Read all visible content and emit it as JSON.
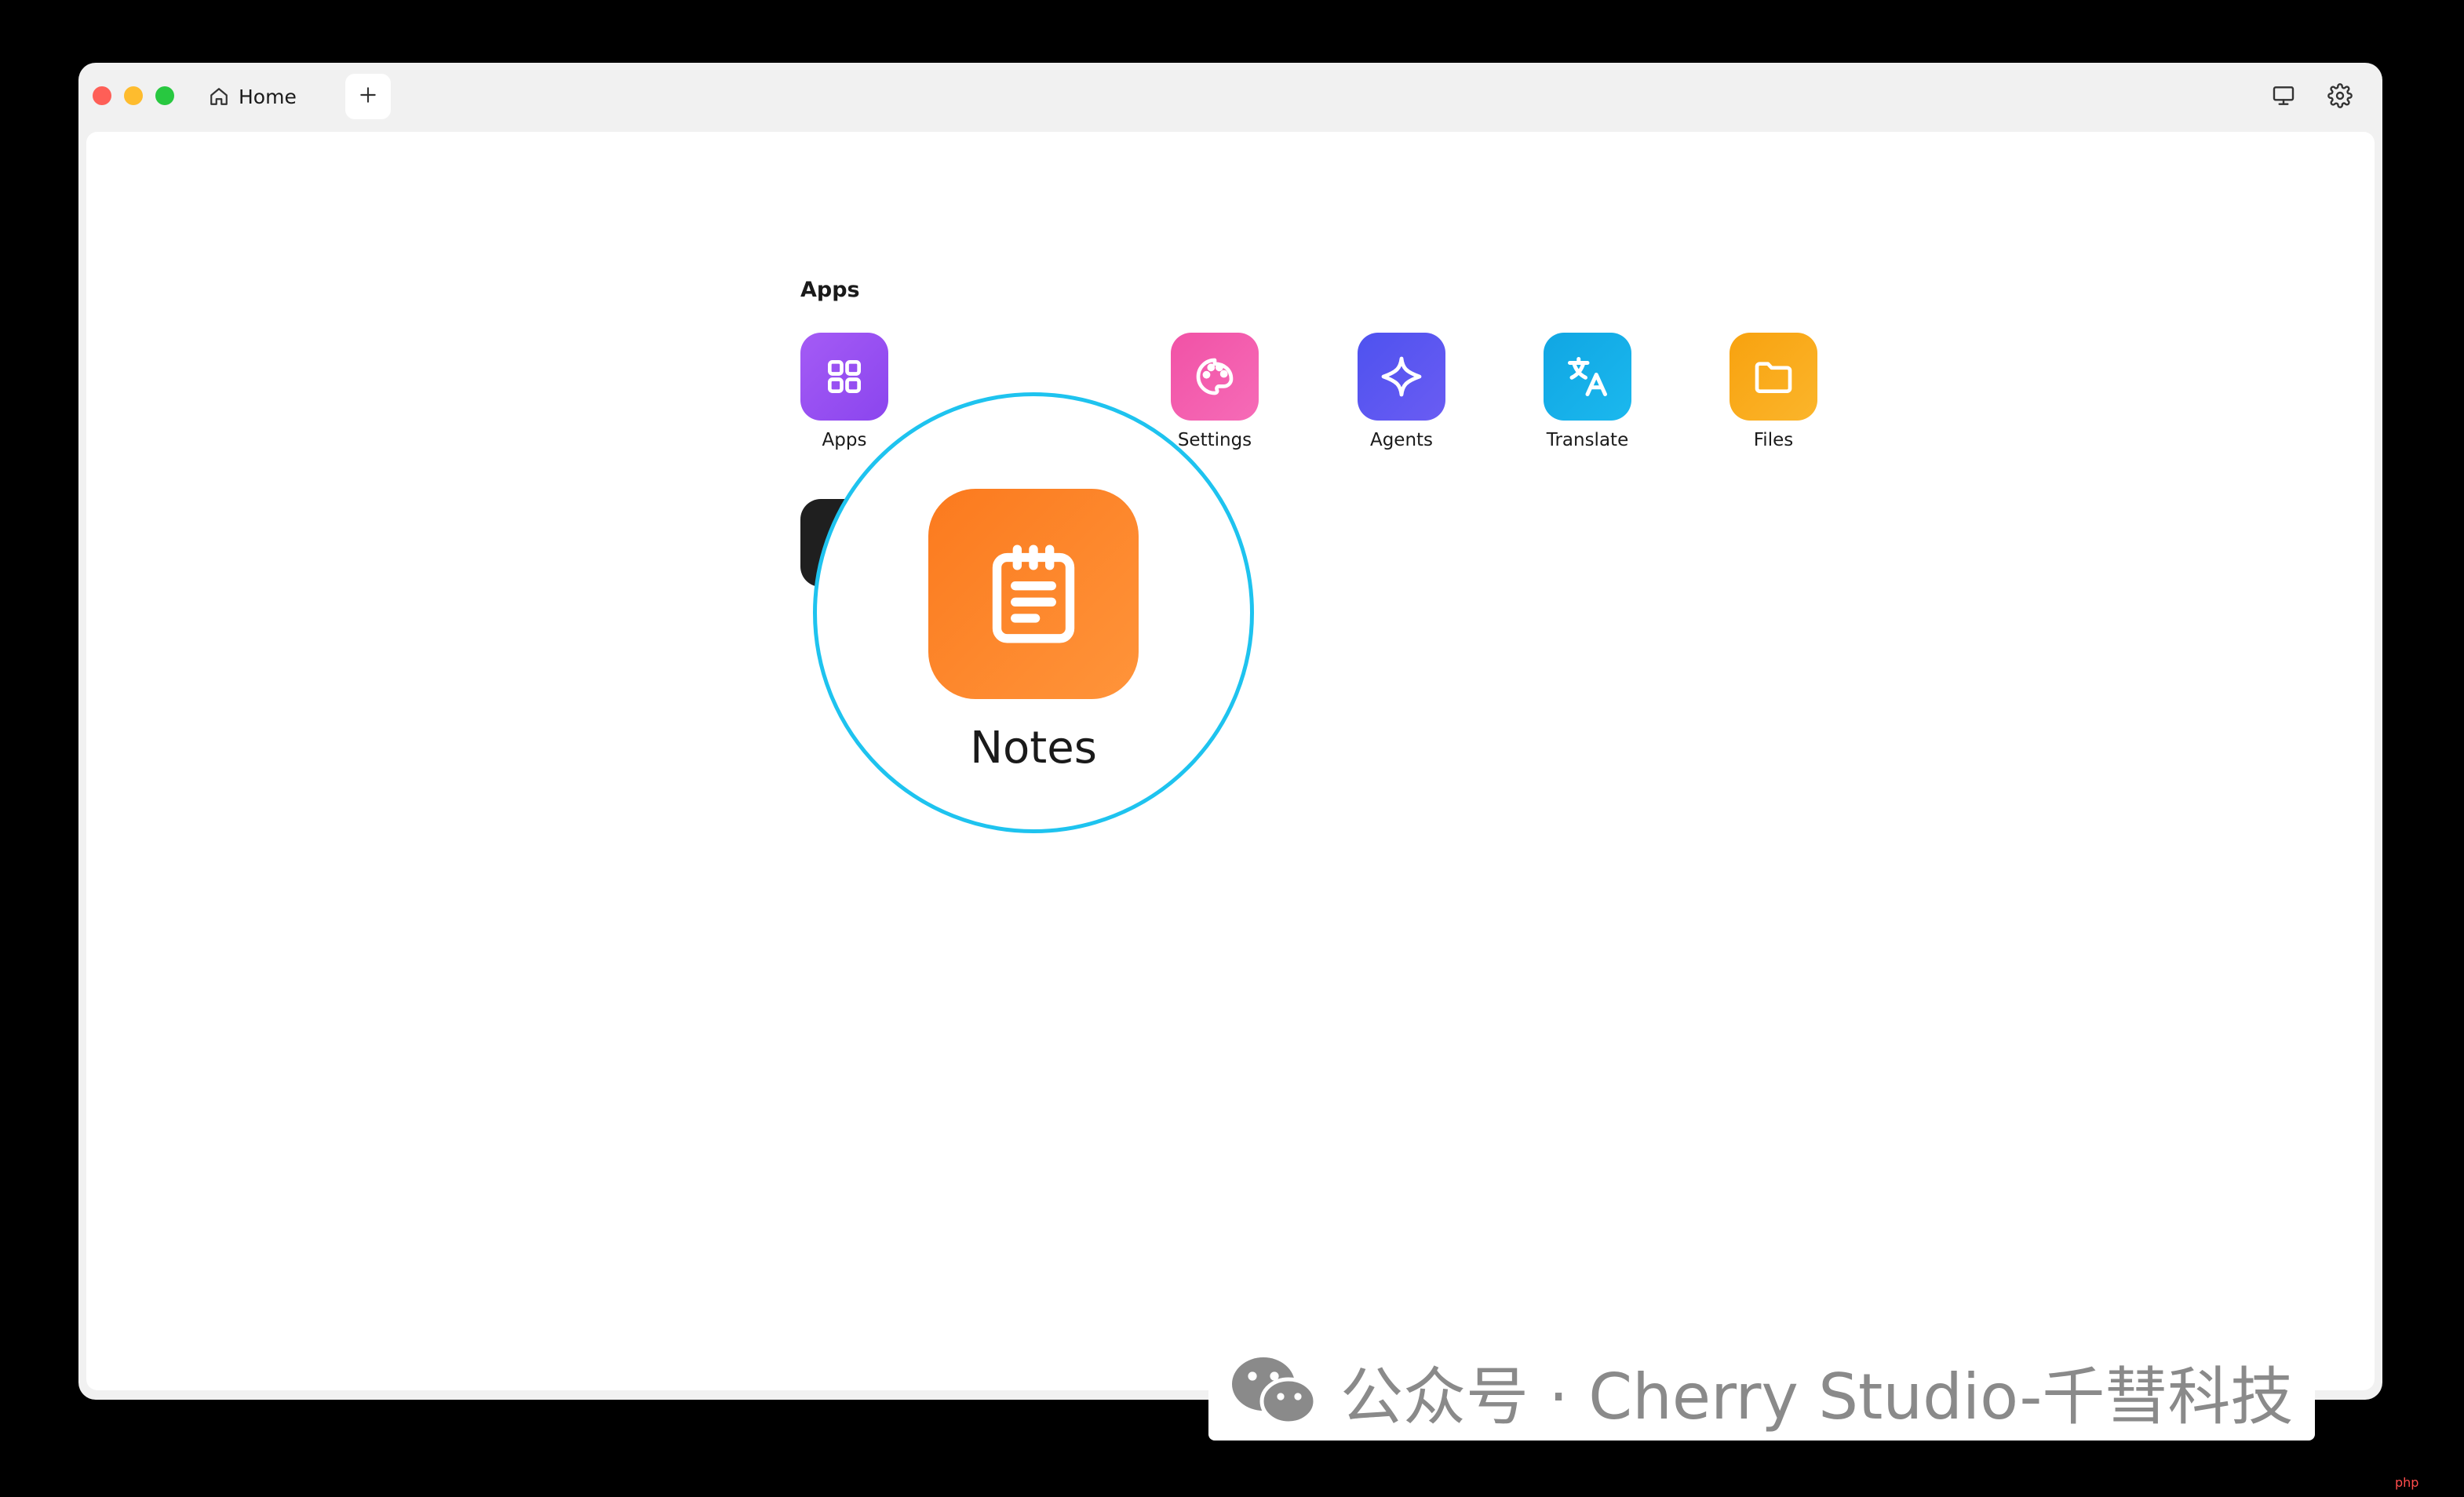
{
  "window": {
    "tab_home_label": "Home"
  },
  "apps_section": {
    "title": "Apps",
    "items": [
      {
        "label": "Apps",
        "icon": "grid-icon",
        "color_from": "#a45bf5",
        "color_to": "#8b45ee"
      },
      {
        "label": "Notes",
        "icon": "notepad-icon",
        "color_from": "#fb7a1e",
        "color_to": "#ff943a"
      },
      {
        "label": "Settings",
        "icon": "palette-icon",
        "color_from": "#f152a6",
        "color_to": "#f66bb7"
      },
      {
        "label": "Agents",
        "icon": "sparkle-icon",
        "color_from": "#4e52ef",
        "color_to": "#6a5cf3"
      },
      {
        "label": "Translate",
        "icon": "translate-icon",
        "color_from": "#10a6e3",
        "color_to": "#1bb8ee"
      },
      {
        "label": "Files",
        "icon": "folder-icon",
        "color_from": "#f8a20f",
        "color_to": "#fbb52b"
      }
    ]
  },
  "magnifier": {
    "label": "Notes",
    "accent": "#1ec3ef"
  },
  "watermark": {
    "text": "公众号 · Cherry Studio-千彗科技",
    "badge": "php"
  }
}
